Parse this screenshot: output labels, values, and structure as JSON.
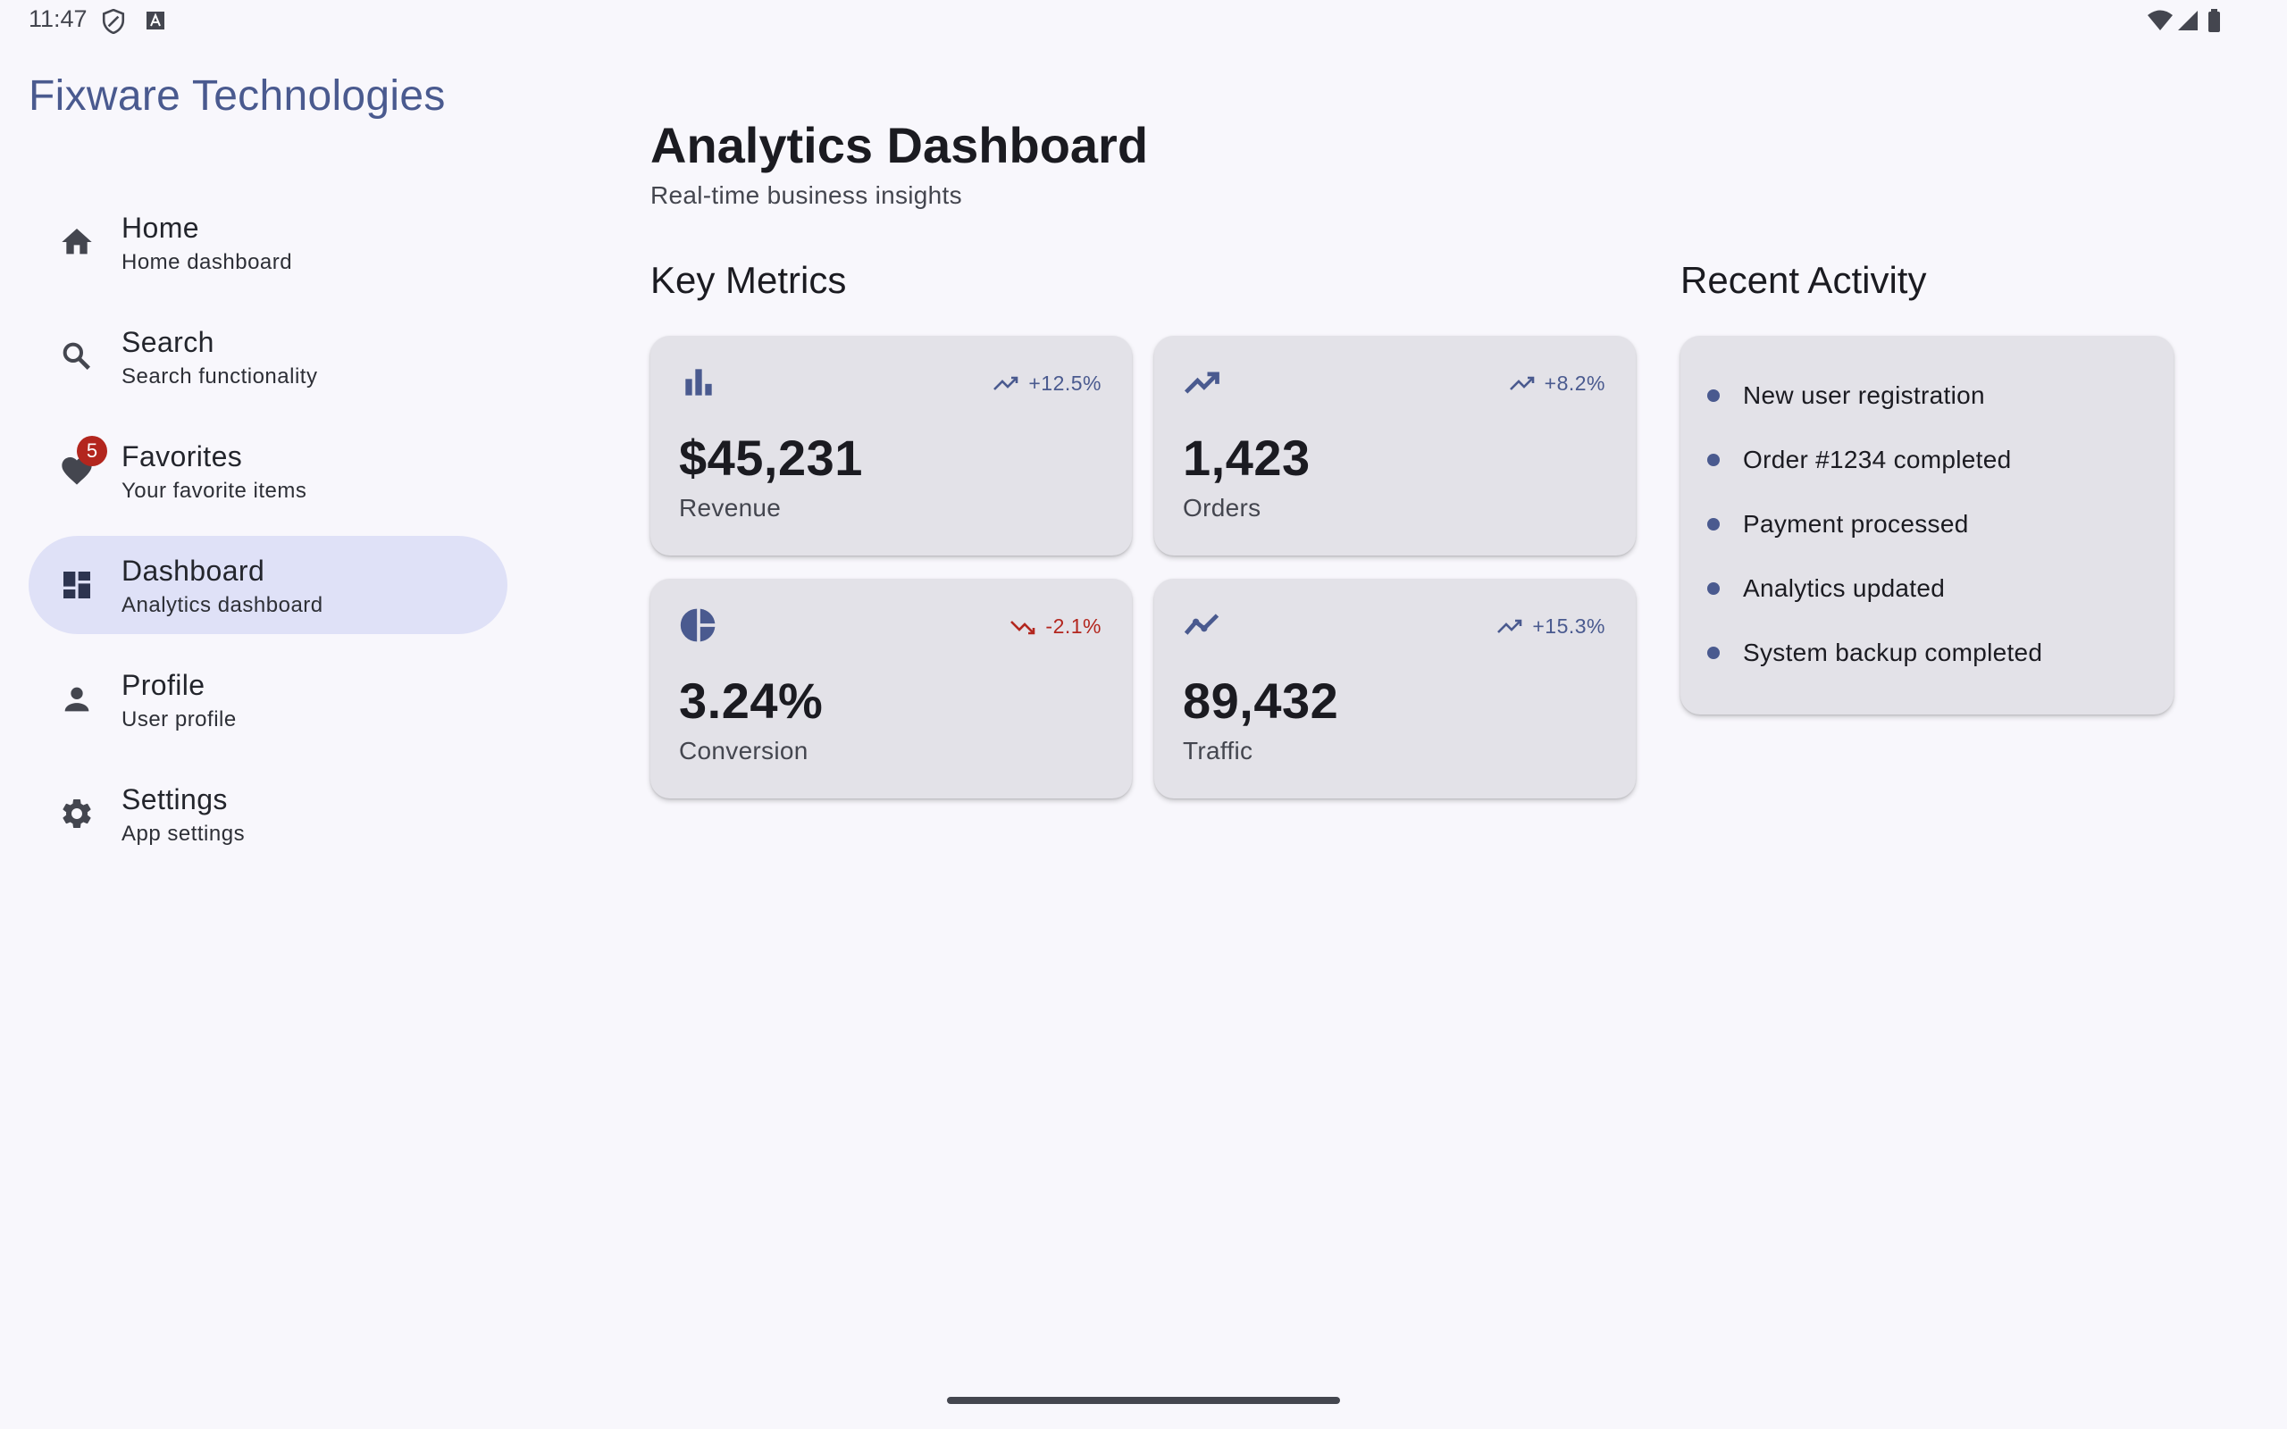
{
  "status_bar": {
    "time": "11:47",
    "icons": [
      "shield-icon",
      "font-a-icon",
      "wifi-icon",
      "signal-icon",
      "battery-icon"
    ]
  },
  "app": {
    "brand": "Fixware Technologies",
    "accent": "#4a5a8f",
    "error_color": "#b3261e"
  },
  "nav": {
    "items": [
      {
        "icon": "home-icon",
        "title": "Home",
        "subtitle": "Home dashboard",
        "active": false
      },
      {
        "icon": "search-icon",
        "title": "Search",
        "subtitle": "Search functionality",
        "active": false
      },
      {
        "icon": "heart-icon",
        "title": "Favorites",
        "subtitle": "Your favorite items",
        "badge": "5",
        "active": false
      },
      {
        "icon": "dashboard-icon",
        "title": "Dashboard",
        "subtitle": "Analytics dashboard",
        "active": true
      },
      {
        "icon": "person-icon",
        "title": "Profile",
        "subtitle": "User profile",
        "active": false
      },
      {
        "icon": "gear-icon",
        "title": "Settings",
        "subtitle": "App settings",
        "active": false
      }
    ]
  },
  "header": {
    "title": "Analytics Dashboard",
    "subtitle": "Real-time business insights"
  },
  "metrics": {
    "section_title": "Key Metrics",
    "cards": [
      {
        "icon": "bar-chart-icon",
        "trend": "+12.5%",
        "trend_dir": "up",
        "value": "$45,231",
        "label": "Revenue"
      },
      {
        "icon": "trending-up-icon",
        "trend": "+8.2%",
        "trend_dir": "up",
        "value": "1,423",
        "label": "Orders"
      },
      {
        "icon": "pie-chart-icon",
        "trend": "-2.1%",
        "trend_dir": "down",
        "value": "3.24%",
        "label": "Conversion"
      },
      {
        "icon": "line-chart-icon",
        "trend": "+15.3%",
        "trend_dir": "up",
        "value": "89,432",
        "label": "Traffic"
      }
    ]
  },
  "activity": {
    "section_title": "Recent Activity",
    "items": [
      "New user registration",
      "Order #1234 completed",
      "Payment processed",
      "Analytics updated",
      "System backup completed"
    ]
  }
}
